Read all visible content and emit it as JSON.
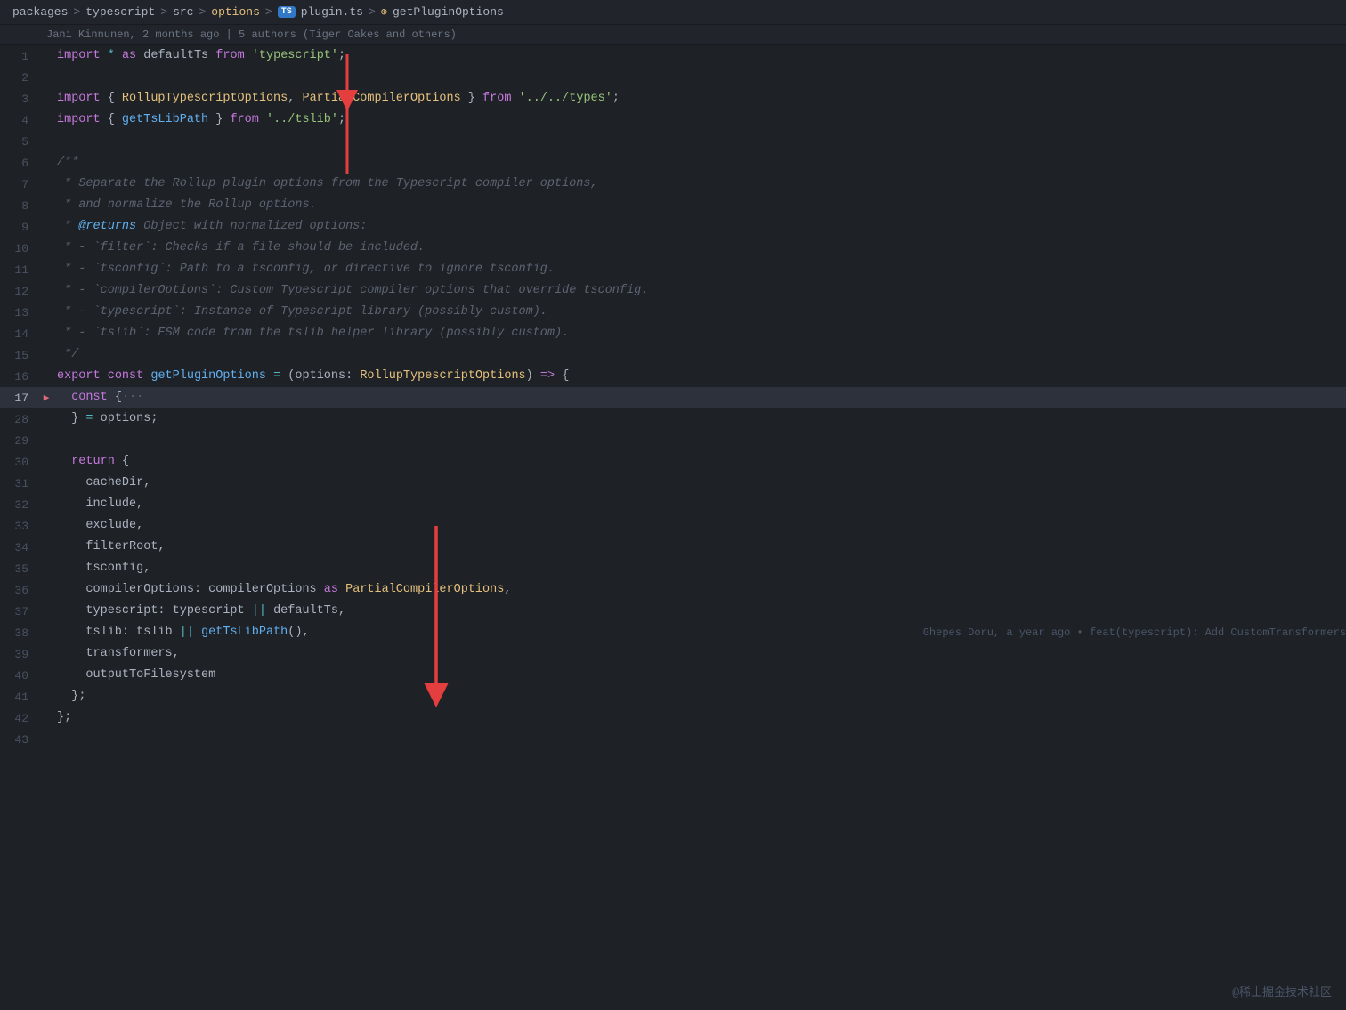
{
  "breadcrumb": {
    "items": [
      "packages",
      "typescript",
      "src",
      "options"
    ],
    "ts_label": "TS",
    "filename": "plugin.ts",
    "func_symbol": "⊕",
    "func_name": "getPluginOptions"
  },
  "git_blame": {
    "text": "Jani Kinnunen, 2 months ago | 5 authors (Tiger Oakes and others)"
  },
  "watermark": "@稀土掘金技术社区",
  "lines": [
    {
      "num": 1,
      "content": "import_line_1"
    },
    {
      "num": 2,
      "content": "empty"
    },
    {
      "num": 3,
      "content": "import_line_3"
    },
    {
      "num": 4,
      "content": "import_line_4"
    },
    {
      "num": 5,
      "content": "empty"
    },
    {
      "num": 6,
      "content": "jsdoc_open"
    },
    {
      "num": 7,
      "content": "jsdoc_7"
    },
    {
      "num": 8,
      "content": "jsdoc_8"
    },
    {
      "num": 9,
      "content": "jsdoc_9"
    },
    {
      "num": 10,
      "content": "jsdoc_10"
    },
    {
      "num": 11,
      "content": "jsdoc_11"
    },
    {
      "num": 12,
      "content": "jsdoc_12"
    },
    {
      "num": 13,
      "content": "jsdoc_13"
    },
    {
      "num": 14,
      "content": "jsdoc_14"
    },
    {
      "num": 15,
      "content": "jsdoc_close"
    },
    {
      "num": 16,
      "content": "export_line"
    },
    {
      "num": 17,
      "content": "const_open",
      "fold": true,
      "highlighted": true
    },
    {
      "num": 28,
      "content": "const_close"
    },
    {
      "num": 29,
      "content": "empty"
    },
    {
      "num": 30,
      "content": "return_open"
    },
    {
      "num": 31,
      "content": "cacheDir"
    },
    {
      "num": 32,
      "content": "include"
    },
    {
      "num": 33,
      "content": "exclude"
    },
    {
      "num": 34,
      "content": "filterRoot"
    },
    {
      "num": 35,
      "content": "tsconfig"
    },
    {
      "num": 36,
      "content": "compilerOptions"
    },
    {
      "num": 37,
      "content": "typescript_line"
    },
    {
      "num": 38,
      "content": "tslib_line",
      "blame": true
    },
    {
      "num": 39,
      "content": "transformers"
    },
    {
      "num": 40,
      "content": "outputToFilesystem"
    },
    {
      "num": 41,
      "content": "return_close"
    },
    {
      "num": 42,
      "content": "func_close"
    },
    {
      "num": 43,
      "content": "empty"
    }
  ]
}
